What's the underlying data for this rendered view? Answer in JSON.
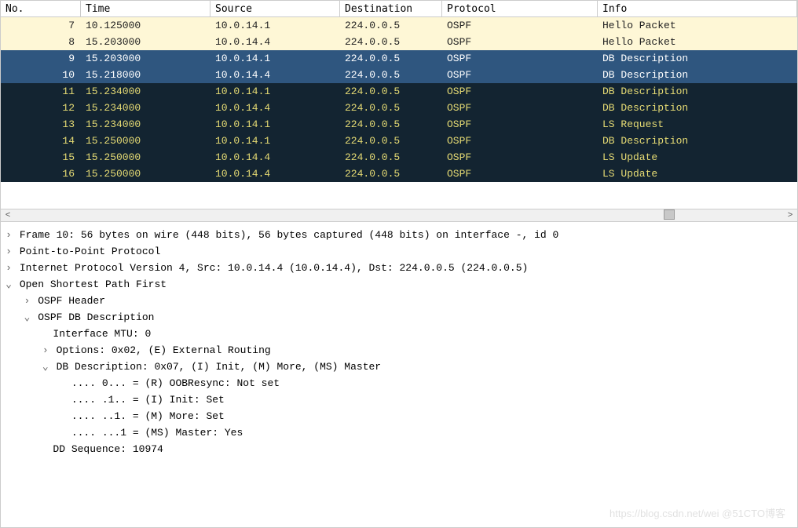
{
  "columns": {
    "no": "No.",
    "time": "Time",
    "source": "Source",
    "destination": "Destination",
    "protocol": "Protocol",
    "info": "Info"
  },
  "packets": [
    {
      "no": "7",
      "time": "10.125000",
      "src": "10.0.14.1",
      "dst": "224.0.0.5",
      "proto": "OSPF",
      "info": "Hello Packet",
      "style": "hello"
    },
    {
      "no": "8",
      "time": "15.203000",
      "src": "10.0.14.4",
      "dst": "224.0.0.5",
      "proto": "OSPF",
      "info": "Hello Packet",
      "style": "hello"
    },
    {
      "no": "9",
      "time": "15.203000",
      "src": "10.0.14.1",
      "dst": "224.0.0.5",
      "proto": "OSPF",
      "info": "DB Description",
      "style": "sel"
    },
    {
      "no": "10",
      "time": "15.218000",
      "src": "10.0.14.4",
      "dst": "224.0.0.5",
      "proto": "OSPF",
      "info": "DB Description",
      "style": "sel"
    },
    {
      "no": "11",
      "time": "15.234000",
      "src": "10.0.14.1",
      "dst": "224.0.0.5",
      "proto": "OSPF",
      "info": "DB Description",
      "style": "ospf"
    },
    {
      "no": "12",
      "time": "15.234000",
      "src": "10.0.14.4",
      "dst": "224.0.0.5",
      "proto": "OSPF",
      "info": "DB Description",
      "style": "ospf"
    },
    {
      "no": "13",
      "time": "15.234000",
      "src": "10.0.14.1",
      "dst": "224.0.0.5",
      "proto": "OSPF",
      "info": "LS Request",
      "style": "ospf"
    },
    {
      "no": "14",
      "time": "15.250000",
      "src": "10.0.14.1",
      "dst": "224.0.0.5",
      "proto": "OSPF",
      "info": "DB Description",
      "style": "ospf"
    },
    {
      "no": "15",
      "time": "15.250000",
      "src": "10.0.14.4",
      "dst": "224.0.0.5",
      "proto": "OSPF",
      "info": "LS Update",
      "style": "ospf"
    },
    {
      "no": "16",
      "time": "15.250000",
      "src": "10.0.14.4",
      "dst": "224.0.0.5",
      "proto": "OSPF",
      "info": "LS Update",
      "style": "ospf"
    }
  ],
  "details": {
    "frame": "Frame 10: 56 bytes on wire (448 bits), 56 bytes captured (448 bits) on interface -, id 0",
    "ppp": "Point-to-Point Protocol",
    "ipv4": "Internet Protocol Version 4, Src: 10.0.14.4 (10.0.14.4), Dst: 224.0.0.5 (224.0.0.5)",
    "ospf": "Open Shortest Path First",
    "ospf_header": "OSPF Header",
    "ospf_dbd": "OSPF DB Description",
    "mtu": "Interface MTU: 0",
    "options": "Options: 0x02, (E) External Routing",
    "dbdesc": "DB Description: 0x07, (I) Init, (M) More, (MS) Master",
    "bit_r": ".... 0... = (R) OOBResync: Not set",
    "bit_i": ".... .1.. = (I) Init: Set",
    "bit_m": ".... ..1. = (M) More: Set",
    "bit_ms": ".... ...1 = (MS) Master: Yes",
    "ddseq": "DD Sequence: 10974"
  },
  "scroll": {
    "left": "<",
    "right": ">"
  },
  "watermark": "https://blog.csdn.net/wei   @51CTO博客"
}
